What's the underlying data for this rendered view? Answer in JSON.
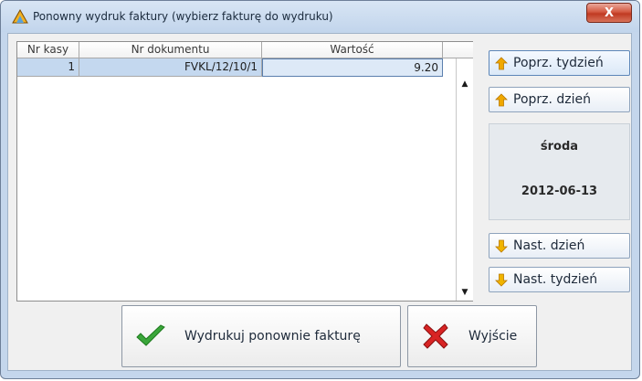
{
  "window": {
    "title": "Ponowny wydruk faktury (wybierz fakturę do wydruku)",
    "close_label": "X"
  },
  "table": {
    "columns": [
      "Nr kasy",
      "Nr dokumentu",
      "Wartość"
    ],
    "rows": [
      {
        "nr_kasy": "1",
        "nr_dokumentu": "FVKL/12/10/1",
        "wartosc": "9.20"
      }
    ]
  },
  "nav": {
    "prev_week": "Poprz. tydzień",
    "prev_day": "Poprz. dzień",
    "next_day": "Nast. dzień",
    "next_week": "Nast. tydzień"
  },
  "date_panel": {
    "day_name": "środa",
    "date": "2012-06-13"
  },
  "actions": {
    "reprint": "Wydrukuj ponownie fakturę",
    "exit": "Wyjście"
  },
  "colors": {
    "arrow_up": "#f0a800",
    "arrow_down": "#f0b400",
    "check": "#3aa63a",
    "cross": "#d82424",
    "close": "#c84a32"
  }
}
